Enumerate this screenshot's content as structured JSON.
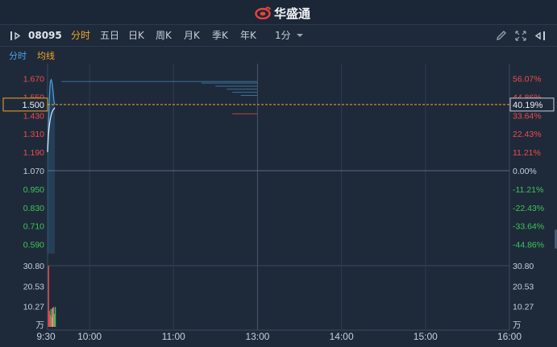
{
  "brand": {
    "name": "华盛通"
  },
  "toolbar": {
    "code": "08095",
    "periods": [
      "分时",
      "五日",
      "日K",
      "周K",
      "月K",
      "季K",
      "年K"
    ],
    "interval": "1分"
  },
  "subtabs": {
    "timeshare": "分时",
    "avg_line": "均线"
  },
  "colors": {
    "up": "#f04a4a",
    "down": "#3fc456",
    "flat": "#c8cfd8",
    "price_line": "#e8eef6",
    "avg_line": "#4aa3e6",
    "cursor": "#f5a623"
  },
  "chart_data": {
    "type": "line",
    "price_axis": {
      "left_ticks": [
        "1.670",
        "1.550",
        "1.430",
        "1.310",
        "1.190",
        "1.070",
        "0.950",
        "0.830",
        "0.710",
        "0.590"
      ],
      "right_ticks": [
        "56.07%",
        "44.86%",
        "33.64%",
        "22.43%",
        "11.21%",
        "0.00%",
        "-11.21%",
        "-22.43%",
        "-33.64%",
        "-44.86%"
      ],
      "values": [
        1.67,
        1.55,
        1.43,
        1.31,
        1.19,
        1.07,
        0.95,
        0.83,
        0.71,
        0.59
      ],
      "ylim": [
        0.53,
        1.73
      ],
      "prev_close": 1.07
    },
    "crosshair": {
      "price": "1.500",
      "change": "40.19%",
      "value": 1.5
    },
    "volume_axis": {
      "ticks": [
        "30.80",
        "20.53",
        "10.27"
      ],
      "values": [
        30.8,
        20.53,
        10.27
      ],
      "unit": "万",
      "ylim": [
        0,
        30.8
      ]
    },
    "time_axis": {
      "ticks": [
        "9:30",
        "10:00",
        "11:00",
        "13:00",
        "14:00",
        "15:00",
        "16:00"
      ],
      "minutes": [
        0,
        30,
        90,
        150,
        210,
        270,
        330
      ],
      "range": [
        0,
        330
      ]
    },
    "price_series": [
      {
        "t": 0,
        "p": 1.2
      },
      {
        "t": 0.4,
        "p": 1.3
      },
      {
        "t": 0.8,
        "p": 1.4
      },
      {
        "t": 1.2,
        "p": 1.52
      },
      {
        "t": 1.6,
        "p": 1.6
      },
      {
        "t": 2,
        "p": 1.65
      },
      {
        "t": 2.6,
        "p": 1.662
      },
      {
        "t": 3.3,
        "p": 1.64
      },
      {
        "t": 4,
        "p": 1.58
      },
      {
        "t": 4.6,
        "p": 1.52
      },
      {
        "t": 5.2,
        "p": 1.5
      }
    ],
    "avg_series": [
      {
        "t": 0,
        "p": 1.19
      },
      {
        "t": 0.6,
        "p": 1.3
      },
      {
        "t": 1.2,
        "p": 1.36
      },
      {
        "t": 2,
        "p": 1.41
      },
      {
        "t": 2.8,
        "p": 1.44
      },
      {
        "t": 3.6,
        "p": 1.46
      },
      {
        "t": 4.4,
        "p": 1.47
      },
      {
        "t": 5.2,
        "p": 1.48
      }
    ],
    "volume_bars": [
      {
        "t": 0.3,
        "v": 30.8,
        "dir": "up"
      },
      {
        "t": 0.9,
        "v": 8.0,
        "dir": "up"
      },
      {
        "t": 1.5,
        "v": 6.0,
        "dir": "up"
      },
      {
        "t": 2.1,
        "v": 9.0,
        "dir": "down"
      },
      {
        "t": 2.7,
        "v": 5.0,
        "dir": "up"
      },
      {
        "t": 3.3,
        "v": 9.5,
        "dir": "flat"
      },
      {
        "t": 3.9,
        "v": 10.0,
        "dir": "up"
      },
      {
        "t": 4.5,
        "v": 6.5,
        "dir": "down"
      },
      {
        "t": 5.1,
        "v": 10.0,
        "dir": "down"
      }
    ],
    "depth_lines": [
      {
        "price": 1.65,
        "t_from": 10,
        "t_to": 150
      },
      {
        "price": 1.64,
        "t_from": 110,
        "t_to": 150
      },
      {
        "price": 1.62,
        "t_from": 120,
        "t_to": 150
      },
      {
        "price": 1.6,
        "t_from": 128,
        "t_to": 150
      },
      {
        "price": 1.58,
        "t_from": 132,
        "t_to": 150
      },
      {
        "price": 1.56,
        "t_from": 138,
        "t_to": 150
      },
      {
        "price": 1.44,
        "t_from": 132,
        "t_to": 150,
        "dir": "up"
      }
    ]
  }
}
